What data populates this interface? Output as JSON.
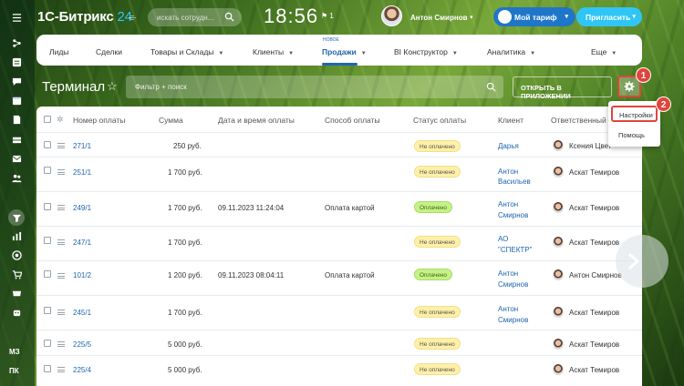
{
  "app": {
    "logo_main": "1С-Битрикс",
    "logo_num": "24"
  },
  "header": {
    "search_placeholder": "искать сотрудн...",
    "time": "18:56",
    "flag_count": "1",
    "user_name": "Антон Смирнов",
    "tariff_label": "Мой тариф",
    "invite_label": "Пригласить"
  },
  "rail": {
    "text_items": [
      "МЗ",
      "ПК"
    ]
  },
  "nav": {
    "items": [
      {
        "label": "Лиды"
      },
      {
        "label": "Сделки"
      },
      {
        "label": "Товары и Склады"
      },
      {
        "label": "Клиенты"
      },
      {
        "label": "Продажи"
      },
      {
        "label": "BI Конструктор"
      },
      {
        "label": "Аналитика"
      },
      {
        "label": "Еще"
      }
    ],
    "new_badge": "НОВОЕ"
  },
  "page": {
    "title": "Терминал",
    "filter_placeholder": "Фильтр + поиск",
    "open_app_label": "ОТКРЫТЬ В ПРИЛОЖЕНИИ",
    "callout_1": "1",
    "callout_2": "2"
  },
  "dropdown": {
    "settings": "Настройки",
    "help": "Помощь"
  },
  "table": {
    "headers": [
      "Номер оплаты",
      "Сумма",
      "Дата и время оплаты",
      "Способ оплаты",
      "Статус оплаты",
      "Клиент",
      "Ответственный"
    ],
    "rows": [
      {
        "id": "271/1",
        "sum": "250 руб.",
        "date": "",
        "method": "",
        "status": "Не оплачено",
        "client1": "Дарья",
        "client2": "",
        "resp": "Ксения Цвет"
      },
      {
        "id": "251/1",
        "sum": "1 700 руб.",
        "date": "",
        "method": "",
        "status": "Не оплачено",
        "client1": "Антон",
        "client2": "Васильев",
        "resp": "Аскат Темиров"
      },
      {
        "id": "249/1",
        "sum": "1 700 руб.",
        "date": "09.11.2023 11:24:04",
        "method": "Оплата картой",
        "status": "Оплачено",
        "client1": "Антон",
        "client2": "Смирнов",
        "resp": "Аскат Темиров"
      },
      {
        "id": "247/1",
        "sum": "1 700 руб.",
        "date": "",
        "method": "",
        "status": "Не оплачено",
        "client1": "АО",
        "client2": "\"СПЕКТР\"",
        "resp": "Аскат Темиров"
      },
      {
        "id": "101/2",
        "sum": "1 200 руб.",
        "date": "09.11.2023 08:04:11",
        "method": "Оплата картой",
        "status": "Оплачено",
        "client1": "Антон",
        "client2": "Смирнов",
        "resp": "Антон Смирнов"
      },
      {
        "id": "245/1",
        "sum": "1 700 руб.",
        "date": "",
        "method": "",
        "status": "Не оплачено",
        "client1": "Антон",
        "client2": "Смирнов",
        "resp": "Аскат Темиров"
      },
      {
        "id": "225/5",
        "sum": "5 000 руб.",
        "date": "",
        "method": "",
        "status": "Не оплачено",
        "client1": "",
        "client2": "",
        "resp": "Аскат Темиров"
      },
      {
        "id": "225/4",
        "sum": "5 000 руб.",
        "date": "",
        "method": "",
        "status": "Не оплачено",
        "client1": "",
        "client2": "",
        "resp": "Аскат Темиров"
      }
    ]
  },
  "colors": {
    "accent": "#2066b0",
    "callout": "#e0453c",
    "paid_bg": "#c6f08a",
    "unpaid_bg": "#fff0a8"
  }
}
